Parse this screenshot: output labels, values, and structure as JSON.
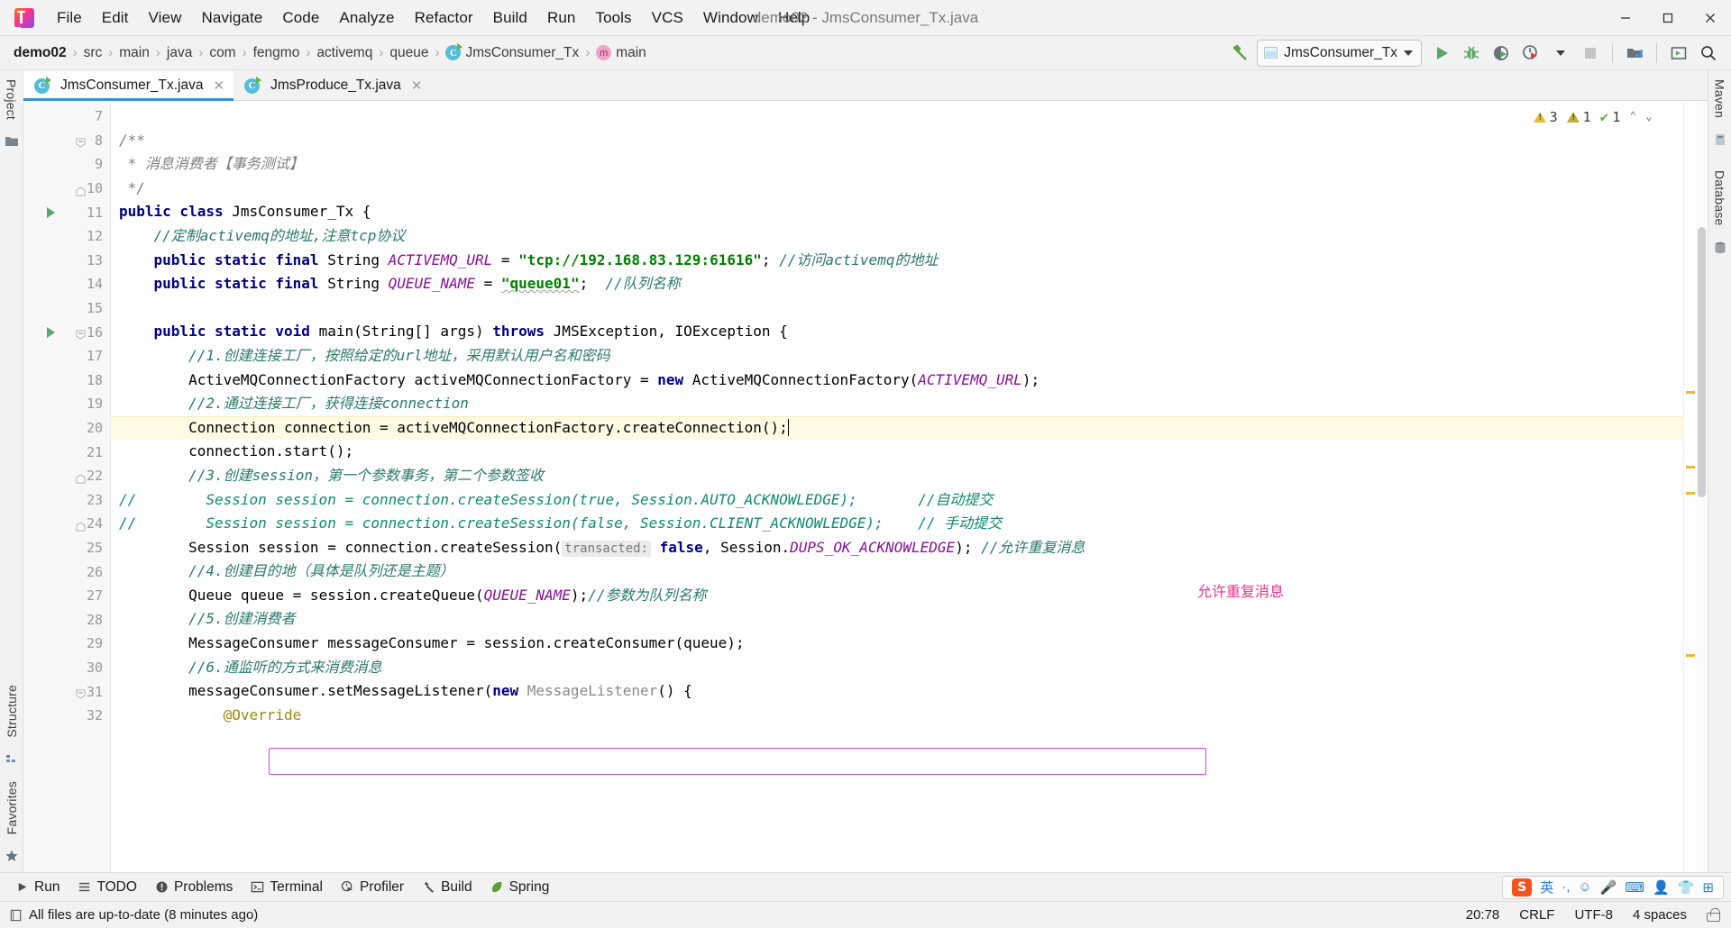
{
  "window": {
    "title": "demo02 - JmsConsumer_Tx.java",
    "minimize": "–",
    "maximize": "□",
    "close": "✕"
  },
  "menubar": {
    "items": [
      {
        "label": "File"
      },
      {
        "label": "Edit"
      },
      {
        "label": "View"
      },
      {
        "label": "Navigate"
      },
      {
        "label": "Code"
      },
      {
        "label": "Analyze"
      },
      {
        "label": "Refactor"
      },
      {
        "label": "Build"
      },
      {
        "label": "Run"
      },
      {
        "label": "Tools"
      },
      {
        "label": "VCS"
      },
      {
        "label": "Window"
      },
      {
        "label": "Help"
      }
    ]
  },
  "breadcrumb": {
    "separator": "›",
    "items": [
      {
        "label": "demo02",
        "icon": "none",
        "bold": true
      },
      {
        "label": "src",
        "icon": "none"
      },
      {
        "label": "main",
        "icon": "none"
      },
      {
        "label": "java",
        "icon": "none"
      },
      {
        "label": "com",
        "icon": "none"
      },
      {
        "label": "fengmo",
        "icon": "none"
      },
      {
        "label": "activemq",
        "icon": "none"
      },
      {
        "label": "queue",
        "icon": "none"
      },
      {
        "label": "JmsConsumer_Tx",
        "icon": "class-icon"
      },
      {
        "label": "main",
        "icon": "method-icon"
      }
    ]
  },
  "toolbar": {
    "build_icon": "hammer-icon",
    "run_config": {
      "label": "JmsConsumer_Tx",
      "icon": "run-config-icon",
      "caret": "▾"
    },
    "buttons": [
      {
        "name": "run-button",
        "icon": "play-icon"
      },
      {
        "name": "debug-button",
        "icon": "bug-icon"
      },
      {
        "name": "run-with-coverage-button",
        "icon": "coverage-icon"
      },
      {
        "name": "profiler-button",
        "icon": "profiler-clock-icon"
      },
      {
        "name": "profiler-dropdown",
        "icon": "chevron-down-icon"
      },
      {
        "name": "stop-button",
        "icon": "stop-square-icon"
      },
      {
        "name": "project-structure-button",
        "icon": "project-structure-icon"
      },
      {
        "name": "terminal-button",
        "icon": "terminal-window-icon"
      },
      {
        "name": "search-everywhere-button",
        "icon": "search-icon"
      }
    ]
  },
  "left_rail": {
    "items": [
      {
        "label": "Project",
        "name": "tool-window-project"
      },
      {
        "label": "Structure",
        "name": "tool-window-structure"
      },
      {
        "label": "Favorites",
        "name": "tool-window-favorites"
      }
    ]
  },
  "right_rail": {
    "items": [
      {
        "label": "Maven",
        "name": "tool-window-maven"
      },
      {
        "label": "Database",
        "name": "tool-window-database"
      }
    ]
  },
  "editor_tabs": [
    {
      "label": "JmsConsumer_Tx.java",
      "icon": "java-class-icon",
      "close": "✕",
      "active": true
    },
    {
      "label": "JmsProduce_Tx.java",
      "icon": "java-class-icon",
      "close": "✕",
      "active": false
    }
  ],
  "inspections": {
    "errors_warnings": "3",
    "weak_warnings": "1",
    "ok_marks": "1",
    "up_chevron": "⌃",
    "down_chevron": "⌄"
  },
  "annotation": {
    "pink_note": "允许重复消息"
  },
  "editor": {
    "first_line_number": 7,
    "current_line": 20,
    "lines": [
      {
        "num": 7,
        "fold": "none",
        "run": false,
        "html": ""
      },
      {
        "num": 8,
        "fold": "open",
        "run": false,
        "html": "<span class=\"cmtblk\">/**</span>"
      },
      {
        "num": 9,
        "fold": "none",
        "run": false,
        "html": "<span class=\"cmtblk\"> * 消息消费者【事务测试】</span>"
      },
      {
        "num": 10,
        "fold": "end",
        "run": false,
        "html": "<span class=\"cmtblk\"> */</span>"
      },
      {
        "num": 11,
        "fold": "none",
        "run": true,
        "html": "<span class=\"kw\">public class</span> <span class=\"cls\">JmsConsumer_Tx</span> {"
      },
      {
        "num": 12,
        "fold": "none",
        "run": false,
        "html": "    <span class=\"cmtcn\">//定制activemq的地址,注意tcp协议</span>"
      },
      {
        "num": 13,
        "fold": "none",
        "run": false,
        "html": "    <span class=\"kw\">public static final</span> <span class=\"cls\">String</span> <span class=\"fld\">ACTIVEMQ_URL</span> = <span class=\"str\">\"tcp://192.168.83.129:61616\"</span>; <span class=\"cmtcn\">//访问activemq的地址</span>"
      },
      {
        "num": 14,
        "fold": "none",
        "run": false,
        "html": "    <span class=\"kw\">public static final</span> <span class=\"cls\">String</span> <span class=\"fld\">QUEUE_NAME</span> = <span class=\"str spell\">\"queue01\"</span>;  <span class=\"cmtcn\">//队列名称</span>"
      },
      {
        "num": 15,
        "fold": "none",
        "run": false,
        "html": ""
      },
      {
        "num": 16,
        "fold": "open",
        "run": true,
        "html": "    <span class=\"kw\">public static void</span> <span class=\"txt\">main</span>(<span class=\"cls\">String</span>[] args) <span class=\"kw\">throws</span> <span class=\"cls\">JMSException</span>, <span class=\"cls\">IOException</span> {"
      },
      {
        "num": 17,
        "fold": "none",
        "run": false,
        "html": "        <span class=\"cmtcn\">//1.创建连接工厂，按照给定的url地址，采用默认用户名和密码</span>"
      },
      {
        "num": 18,
        "fold": "none",
        "run": false,
        "html": "        <span class=\"cls\">ActiveMQConnectionFactory</span> activeMQConnectionFactory = <span class=\"kw\">new</span> <span class=\"cls\">ActiveMQConnectionFactory</span>(<span class=\"fld\">ACTIVEMQ_URL</span>);"
      },
      {
        "num": 19,
        "fold": "none",
        "run": false,
        "html": "        <span class=\"cmtcn\">//2.通过连接工厂，获得连接connection</span>"
      },
      {
        "num": 20,
        "fold": "none",
        "run": false,
        "html": "        <span class=\"cls\">Connection</span> connection = activeMQConnectionFactory.createConnection();<span class=\"cursor\"></span>"
      },
      {
        "num": 21,
        "fold": "none",
        "run": false,
        "html": "        connection.start();"
      },
      {
        "num": 22,
        "fold": "end",
        "run": false,
        "html": "        <span class=\"cmtcn\">//3.创建session，第一个参数事务，第二个参数签收</span>"
      },
      {
        "num": 23,
        "fold": "none",
        "run": false,
        "html": "<span class=\"cmt2\">//</span>        <span class=\"cmt2\">Session session = connection.createSession(true, Session.AUTO_ACKNOWLEDGE);       //自动提交</span>"
      },
      {
        "num": 24,
        "fold": "end",
        "run": false,
        "html": "<span class=\"cmt2\">//</span>        <span class=\"cmt2\">Session session = connection.createSession(false, Session.CLIENT_ACKNOWLEDGE);    // 手动提交</span>"
      },
      {
        "num": 25,
        "fold": "none",
        "run": false,
        "html": "        <span class=\"cls\">Session</span> session = connection.createSession(<span class=\"hint\">transacted:</span> <span class=\"kw\">false</span>, <span class=\"cls\">Session</span>.<span class=\"fld\">DUPS_OK_ACKNOWLEDGE</span>); <span class=\"cmtcn\">//允许重复消息</span>"
      },
      {
        "num": 26,
        "fold": "none",
        "run": false,
        "html": "        <span class=\"cmtcn\">//4.创建目的地（具体是队列还是主题）</span>"
      },
      {
        "num": 27,
        "fold": "none",
        "run": false,
        "html": "        <span class=\"cls\">Queue</span> queue = session.createQueue(<span class=\"fld\">QUEUE_NAME</span>);<span class=\"cmtcn\">//参数为队列名称</span>"
      },
      {
        "num": 28,
        "fold": "none",
        "run": false,
        "html": "        <span class=\"cmtcn\">//5.创建消费者</span>"
      },
      {
        "num": 29,
        "fold": "none",
        "run": false,
        "html": "        <span class=\"cls\">MessageConsumer</span> messageConsumer = session.createConsumer(queue);"
      },
      {
        "num": 30,
        "fold": "none",
        "run": false,
        "html": "        <span class=\"cmtcn\">//6.通监听的方式来消费消息</span>"
      },
      {
        "num": 31,
        "fold": "open",
        "run": false,
        "html": "        messageConsumer.setMessageListener(<span class=\"kw\">new</span> <span class=\"cls\" style=\"color:#8a8a8a\">MessageListener</span>() {"
      },
      {
        "num": 32,
        "fold": "none",
        "run": false,
        "html": "            <span style=\"color:#9e880d\">@Override</span>"
      }
    ]
  },
  "bottom_tool_windows": [
    {
      "label": "Run",
      "icon": "play-icon",
      "name": "bottom-run"
    },
    {
      "label": "TODO",
      "icon": "list-icon",
      "name": "bottom-todo"
    },
    {
      "label": "Problems",
      "icon": "problems-icon",
      "name": "bottom-problems"
    },
    {
      "label": "Terminal",
      "icon": "terminal-icon",
      "name": "bottom-terminal"
    },
    {
      "label": "Profiler",
      "icon": "profiler-icon",
      "name": "bottom-profiler"
    },
    {
      "label": "Build",
      "icon": "hammer-icon",
      "name": "bottom-build"
    },
    {
      "label": "Spring",
      "icon": "leaf-icon",
      "name": "bottom-spring"
    }
  ],
  "ime_bar": {
    "logo": "S",
    "items": [
      "英",
      "·,",
      "☺",
      "🎤",
      "⌨",
      "👤",
      "👕",
      "⊞"
    ]
  },
  "statusbar": {
    "message": "All files are up-to-date (8 minutes ago)",
    "message_icon": "book-icon",
    "position": "20:78",
    "line_separator": "CRLF",
    "encoding": "UTF-8",
    "indent": "4 spaces",
    "lock_icon": "unlocked-icon"
  },
  "colors": {
    "accent_blue": "#3c8fd4",
    "run_green": "#62b543",
    "warning_yellow": "#e8b931",
    "pink_box": "#cc4bd0",
    "pink_text": "#e8368f",
    "current_line": "#fffae3"
  }
}
